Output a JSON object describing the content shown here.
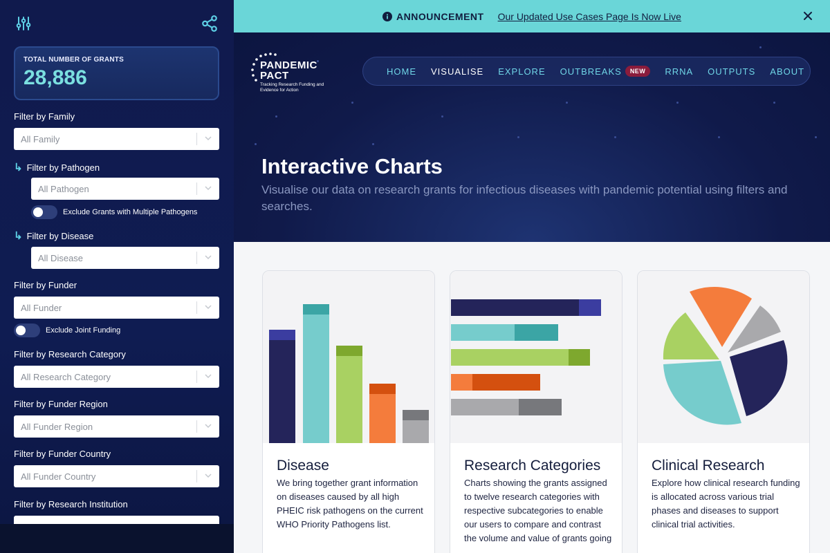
{
  "sidebar": {
    "total_label": "TOTAL NUMBER OF GRANTS",
    "total_value": "28,886",
    "filters": {
      "family": {
        "label": "Filter by Family",
        "placeholder": "All Family"
      },
      "pathogen": {
        "label": "Filter by Pathogen",
        "placeholder": "All Pathogen"
      },
      "exclude_multiple_pathogens": "Exclude Grants with Multiple Pathogens",
      "disease": {
        "label": "Filter by Disease",
        "placeholder": "All Disease"
      },
      "funder": {
        "label": "Filter by Funder",
        "placeholder": "All Funder"
      },
      "exclude_joint_funding": "Exclude Joint Funding",
      "research_category": {
        "label": "Filter by Research Category",
        "placeholder": "All Research Category"
      },
      "funder_region": {
        "label": "Filter by Funder Region",
        "placeholder": "All Funder Region"
      },
      "funder_country": {
        "label": "Filter by Funder Country",
        "placeholder": "All Funder Country"
      },
      "research_institution": {
        "label": "Filter by Research Institution"
      }
    }
  },
  "announcement": {
    "title": "ANNOUNCEMENT",
    "link": "Our Updated Use Cases Page Is Now Live"
  },
  "logo": {
    "line1": "PANDEMIC",
    "line2": "PACT",
    "tagline": "Tracking Research Funding and Evidence for Action"
  },
  "nav": {
    "items": [
      "HOME",
      "VISUALISE",
      "EXPLORE",
      "OUTBREAKS",
      "RRNA",
      "OUTPUTS",
      "ABOUT"
    ],
    "active": "VISUALISE",
    "badge": "NEW"
  },
  "hero": {
    "title": "Interactive Charts",
    "subtitle": "Visualise our data on research grants for infectious diseases with pandemic potential using filters and searches."
  },
  "cards": [
    {
      "title": "Disease",
      "text": "We bring together grant information on diseases caused by all high PHEIC risk pathogens on the current WHO Priority Pathogens list."
    },
    {
      "title": "Research Categories",
      "text": "Charts showing the grants assigned to twelve research categories with respective subcategories to enable our users to compare and contrast the volume and value of grants going"
    },
    {
      "title": "Clinical Research",
      "text": "Explore how clinical research funding is allocated across various trial phases and diseases to support clinical trial activities."
    }
  ],
  "colors": {
    "sidebar_bg": "#101a4d",
    "announcement_bg": "#6ad6d8",
    "accent_teal": "#6fd5e6",
    "navy": "#24245a",
    "teal": "#76cccc",
    "green": "#a9d162",
    "orange": "#f47c3c",
    "gray": "#a9a9ac"
  }
}
